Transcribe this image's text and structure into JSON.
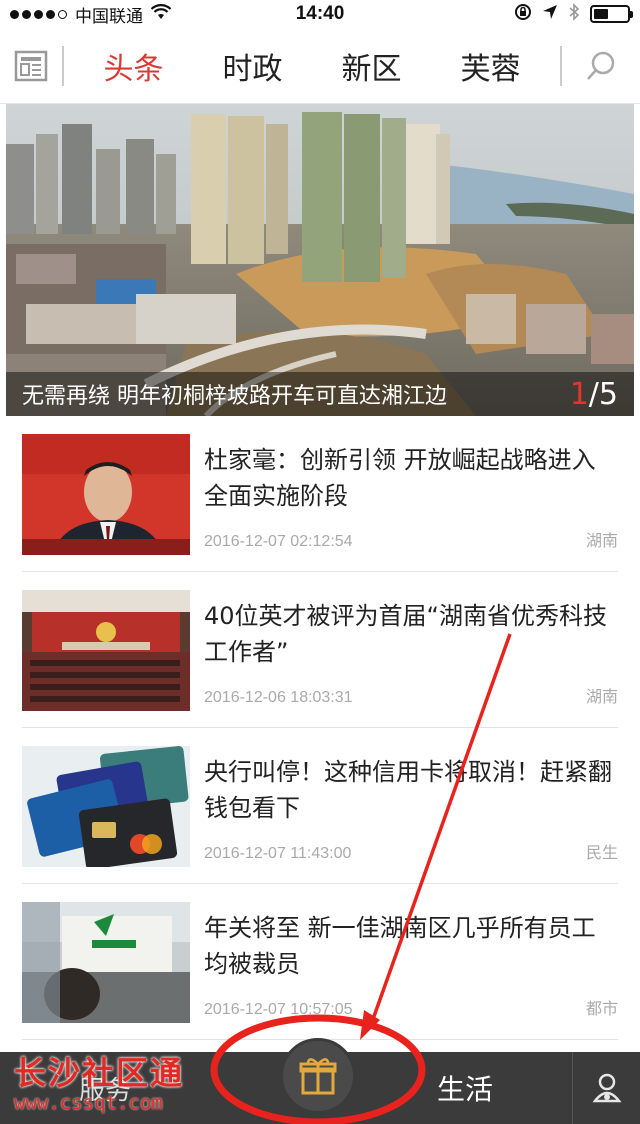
{
  "status_bar": {
    "carrier": "中国联通",
    "time": "14:40"
  },
  "nav": {
    "tabs": [
      {
        "label": "头条",
        "active": true
      },
      {
        "label": "时政",
        "active": false
      },
      {
        "label": "新区",
        "active": false
      },
      {
        "label": "芙蓉",
        "active": false
      }
    ],
    "menu_icon": "newspaper-icon",
    "search_icon": "search-icon"
  },
  "banner": {
    "caption": "无需再绕 明年初桐梓坡路开车可直达湘江边",
    "page_current": "1",
    "page_total": "/5"
  },
  "news": [
    {
      "title": "杜家毫：创新引领 开放崛起战略进入全面实施阶段",
      "time": "2016-12-07 02:12:54",
      "tag": "湖南"
    },
    {
      "title": "40位英才被评为首届“湖南省优秀科技工作者”",
      "time": "2016-12-06 18:03:31",
      "tag": "湖南"
    },
    {
      "title": "央行叫停！这种信用卡将取消！赶紧翻钱包看下",
      "time": "2016-12-07 11:43:00",
      "tag": "民生"
    },
    {
      "title": "年关将至 新一佳湖南区几乎所有员工均被裁员",
      "time": "2016-12-07 10:57:05",
      "tag": "都市"
    }
  ],
  "bottom_bar": {
    "left_label": "服务",
    "life_label": "生活",
    "center_icon": "gift-box-icon",
    "profile_icon": "user-icon"
  },
  "watermark": {
    "title": "长沙社区通",
    "url": "www.cssqt.com"
  },
  "colors": {
    "accent": "#d93b34",
    "bottom_bar": "#3b3b3b",
    "annotation": "#e8231d"
  }
}
